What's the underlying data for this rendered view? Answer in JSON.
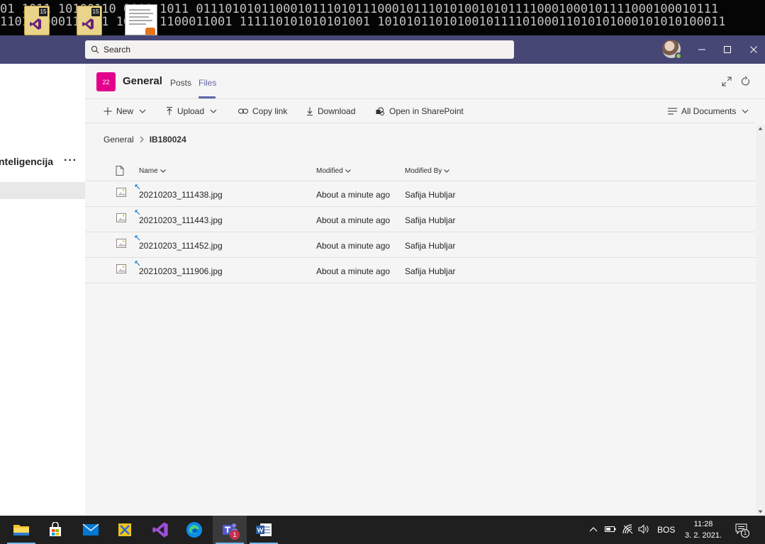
{
  "desktop": {
    "binary_row1": "01 1011 10100110 0101 1011 011101010110001011101011100010111010100101011110001000101111000100010111",
    "binary_row2": "1101 100011 101 10101 1100011001 111110101010101001 101010110101001011110100011010101000101010100011",
    "vs_badge_1": "15",
    "vs_badge_2": "15"
  },
  "titlebar": {
    "search_placeholder": "Search",
    "colors": {
      "bg": "#464775"
    }
  },
  "leftpanel": {
    "team_name": "nteligencija",
    "more": "···"
  },
  "channel": {
    "avatar_text": "22",
    "title": "General",
    "tabs": [
      {
        "label": "Posts",
        "active": false
      },
      {
        "label": "Files",
        "active": true
      }
    ]
  },
  "toolbar": {
    "new_label": "New",
    "upload_label": "Upload",
    "copy_link_label": "Copy link",
    "download_label": "Download",
    "open_sharepoint_label": "Open in SharePoint",
    "view_label": "All Documents"
  },
  "breadcrumb": {
    "root": "General",
    "current": "IB180024"
  },
  "files": {
    "columns": {
      "name": "Name",
      "modified": "Modified",
      "modified_by": "Modified By"
    },
    "rows": [
      {
        "name": "20210203_111438.jpg",
        "modified": "About a minute ago",
        "modified_by": "Safija Hubljar"
      },
      {
        "name": "20210203_111443.jpg",
        "modified": "About a minute ago",
        "modified_by": "Safija Hubljar"
      },
      {
        "name": "20210203_111452.jpg",
        "modified": "About a minute ago",
        "modified_by": "Safija Hubljar"
      },
      {
        "name": "20210203_111906.jpg",
        "modified": "About a minute ago",
        "modified_by": "Safija Hubljar"
      }
    ]
  },
  "taskbar": {
    "apps": [
      "file-explorer",
      "microsoft-store",
      "mail",
      "snipping-tool",
      "visual-studio",
      "edge",
      "teams",
      "word"
    ],
    "teams_badge": "1",
    "language": "BOS",
    "time": "11:28",
    "date": "3. 2. 2021.",
    "notification_count": "1"
  }
}
